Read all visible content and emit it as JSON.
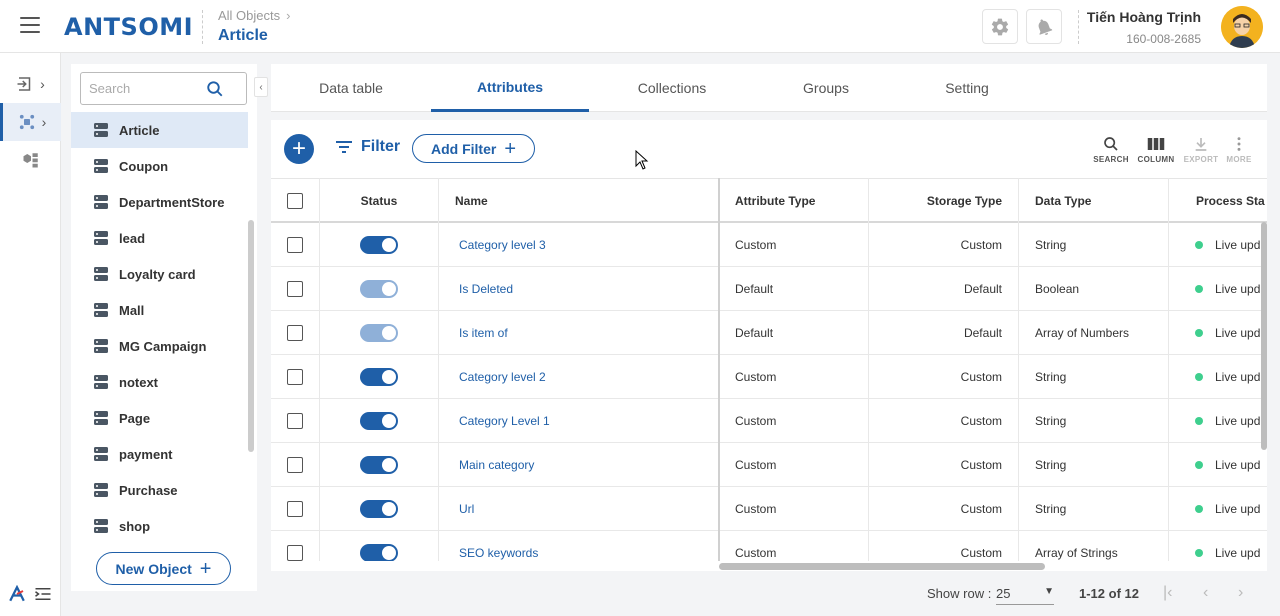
{
  "header": {
    "logo": "ANTSOMI",
    "breadcrumb": "All Objects",
    "title": "Article",
    "user_name": "Tiến Hoàng Trịnh",
    "user_id": "160-008-2685"
  },
  "sidebar": {
    "search_placeholder": "Search",
    "items": [
      {
        "label": "Article",
        "active": true
      },
      {
        "label": "Coupon"
      },
      {
        "label": "DepartmentStore"
      },
      {
        "label": "lead"
      },
      {
        "label": "Loyalty card"
      },
      {
        "label": "Mall"
      },
      {
        "label": "MG Campaign"
      },
      {
        "label": "notext"
      },
      {
        "label": "Page"
      },
      {
        "label": "payment"
      },
      {
        "label": "Purchase"
      },
      {
        "label": "shop"
      }
    ],
    "new_object_label": "New Object"
  },
  "tabs": [
    {
      "label": "Data table"
    },
    {
      "label": "Attributes",
      "active": true
    },
    {
      "label": "Collections"
    },
    {
      "label": "Groups"
    },
    {
      "label": "Setting"
    }
  ],
  "toolbar": {
    "filter_label": "Filter",
    "add_filter_label": "Add Filter",
    "search_label": "SEARCH",
    "column_label": "COLUMN",
    "export_label": "EXPORT",
    "more_label": "MORE"
  },
  "table": {
    "columns": [
      "Status",
      "Name",
      "Attribute Type",
      "Storage Type",
      "Data Type",
      "Process Sta"
    ],
    "rows": [
      {
        "enabled": true,
        "dim": false,
        "name": "Category level 3",
        "attr_type": "Custom",
        "storage": "Custom",
        "data_type": "String",
        "process": "Live upd"
      },
      {
        "enabled": true,
        "dim": true,
        "name": "Is Deleted",
        "attr_type": "Default",
        "storage": "Default",
        "data_type": "Boolean",
        "process": "Live upd"
      },
      {
        "enabled": true,
        "dim": true,
        "name": "Is item of",
        "attr_type": "Default",
        "storage": "Default",
        "data_type": "Array of Numbers",
        "process": "Live upd"
      },
      {
        "enabled": true,
        "dim": false,
        "name": "Category level 2",
        "attr_type": "Custom",
        "storage": "Custom",
        "data_type": "String",
        "process": "Live upd"
      },
      {
        "enabled": true,
        "dim": false,
        "name": "Category Level 1",
        "attr_type": "Custom",
        "storage": "Custom",
        "data_type": "String",
        "process": "Live upd"
      },
      {
        "enabled": true,
        "dim": false,
        "name": "Main category",
        "attr_type": "Custom",
        "storage": "Custom",
        "data_type": "String",
        "process": "Live upd"
      },
      {
        "enabled": true,
        "dim": false,
        "name": "Url",
        "attr_type": "Custom",
        "storage": "Custom",
        "data_type": "String",
        "process": "Live upd"
      },
      {
        "enabled": true,
        "dim": false,
        "name": "SEO keywords",
        "attr_type": "Custom",
        "storage": "Custom",
        "data_type": "Array of Strings",
        "process": "Live upd"
      }
    ]
  },
  "pager": {
    "show_row_label": "Show row :",
    "rows_per_page": "25",
    "range": "1-12 of 12"
  },
  "colors": {
    "accent": "#1f5fa8",
    "status_live": "#3ecf8e"
  }
}
